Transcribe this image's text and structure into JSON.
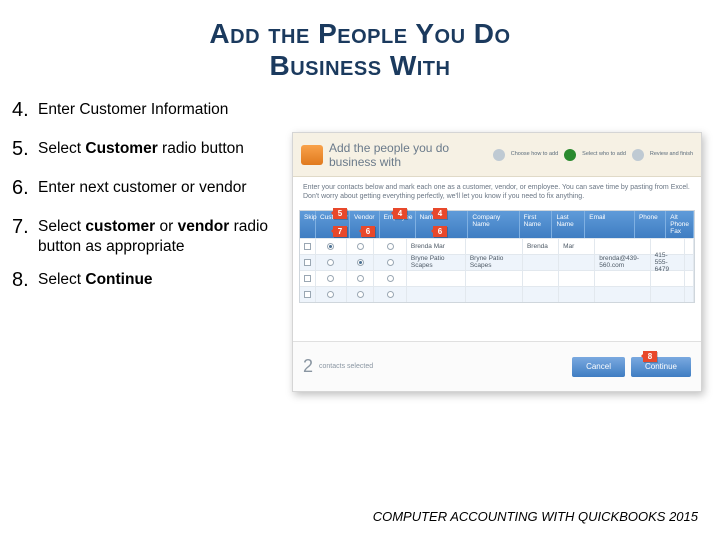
{
  "title_line1": "Add the People You Do",
  "title_line2": "Business With",
  "steps": [
    {
      "n": "4.",
      "plain": "Enter Customer Information"
    },
    {
      "n": "5.",
      "before": "Select ",
      "bold": "Customer",
      "after": " radio button"
    },
    {
      "n": "6.",
      "plain": "Enter next customer or vendor"
    },
    {
      "n": "7.",
      "before": "Select ",
      "bold": "customer",
      "mid": " or ",
      "bold2": "vendor",
      "after": " radio button as appropriate"
    },
    {
      "n": "8.",
      "before": "Select ",
      "bold": "Continue"
    }
  ],
  "panel": {
    "title": "Add the people you do business with",
    "sub": "Enter your contacts below and mark each one as a customer, vendor, or employee. You can save time by pasting from Excel. Don't worry about getting everything perfectly, we'll let you know if you need to fix anything.",
    "wizard": [
      "Choose how to add",
      "Select who to add",
      "Review and finish"
    ],
    "headers": [
      "Skip",
      "Customer",
      "Vendor",
      "Employee",
      "Name",
      "Company Name",
      "First Name",
      "Last Name",
      "Email",
      "Phone",
      "Alt Phone   Fax"
    ],
    "rows": [
      {
        "name": "Brenda Mar",
        "company": "",
        "first": "Brenda",
        "last": "Mar",
        "email": "",
        "phone": "",
        "alt": ""
      },
      {
        "name": "Bryne Patio Scapes",
        "company": "Bryne Patio Scapes",
        "first": "",
        "last": "",
        "email": "brenda@439-560.com",
        "phone": "415-555-6479",
        "alt": ""
      },
      {
        "name": "",
        "company": "",
        "first": "",
        "last": "",
        "email": "",
        "phone": "",
        "alt": ""
      },
      {
        "name": "",
        "company": "",
        "first": "",
        "last": "",
        "email": "",
        "phone": "",
        "alt": ""
      }
    ],
    "selected_count_num": "2",
    "selected_count_label": "contacts selected",
    "cancel": "Cancel",
    "continue": "Continue"
  },
  "callouts": {
    "a": "5",
    "b": "4",
    "c": "4",
    "d": "7",
    "e": "6",
    "f": "6",
    "g": "8"
  },
  "footer": "COMPUTER ACCOUNTING WITH QUICKBOOKS 2015"
}
